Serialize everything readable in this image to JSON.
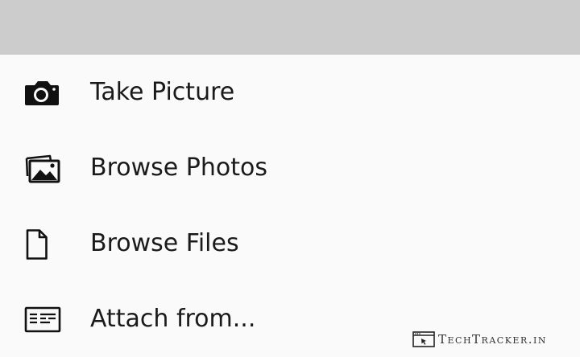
{
  "menu": {
    "items": [
      {
        "label": "Take Picture",
        "icon": "camera-icon"
      },
      {
        "label": "Browse Photos",
        "icon": "photos-icon"
      },
      {
        "label": "Browse Files",
        "icon": "file-icon"
      },
      {
        "label": "Attach from...",
        "icon": "attach-card-icon"
      }
    ]
  },
  "watermark": {
    "text": "TechTracker.in",
    "icon": "techtracker-logo"
  },
  "colors": {
    "top_bar": "#cccccc",
    "sheet_background": "#fafafa",
    "text": "#1a1a1a"
  }
}
